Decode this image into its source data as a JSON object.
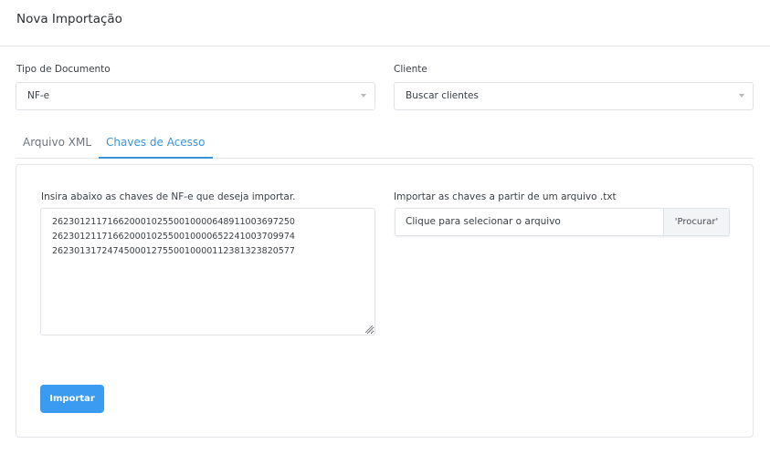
{
  "header": {
    "title": "Nova Importação"
  },
  "form": {
    "document_type": {
      "label": "Tipo de Documento",
      "value": "NF-e"
    },
    "client": {
      "label": "Cliente",
      "value": "Buscar clientes"
    }
  },
  "tabs": [
    {
      "label": "Arquivo XML",
      "active": false
    },
    {
      "label": "Chaves de Acesso",
      "active": true
    }
  ],
  "panel": {
    "keys_label": "Insira abaixo as chaves de NF-e que deseja importar.",
    "keys": [
      "26230121171662000102550010000648911003697250",
      "26230121171662000102550010000652241003709974",
      "26230131724745000127550010000112381323820577"
    ],
    "file_label": "Importar as chaves a partir de um arquivo .txt",
    "file_placeholder": "Clique para selecionar o arquivo",
    "browse_label": "'Procurar'",
    "import_button": "Importar"
  },
  "colors": {
    "accent": "#3a93d8",
    "button": "#3a9bf0"
  }
}
